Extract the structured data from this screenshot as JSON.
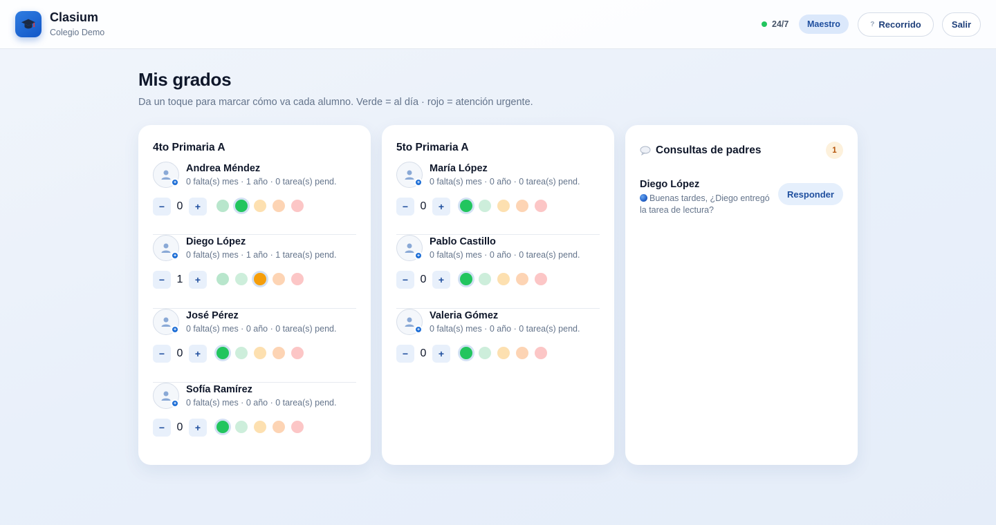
{
  "brand": {
    "name": "Clasium",
    "subtitle": "Colegio Demo"
  },
  "header": {
    "status_text": "24/7",
    "role": "Maestro",
    "tour_label": "Recorrido",
    "tour_icon": "?",
    "exit_label": "Salir"
  },
  "page": {
    "title": "Mis grados",
    "subtitle": "Da un toque para marcar cómo va cada alumno. Verde = al día · rojo = atención urgente."
  },
  "colors": {
    "green": "#22c55e",
    "green_light": "#b8e6cc",
    "mint_light": "#cdeedb",
    "amber": "#f59e0b",
    "amber_light": "#fde0b0",
    "orange_light": "#fdd4b4",
    "red_light": "#fcc6c6",
    "accent": "#1f6fd6"
  },
  "classes": [
    {
      "title": "4to Primaria A",
      "students": [
        {
          "name": "Andrea Méndez",
          "meta": "0 falta(s) mes · 1 año · 0 tarea(s) pend.",
          "count": "0",
          "status": 1,
          "minus": "−",
          "plus": "+"
        },
        {
          "name": "Diego López",
          "meta": "0 falta(s) mes · 1 año · 1 tarea(s) pend.",
          "count": "1",
          "status": 2,
          "minus": "−",
          "plus": "+"
        },
        {
          "name": "José Pérez",
          "meta": "0 falta(s) mes · 0 año · 0 tarea(s) pend.",
          "count": "0",
          "status": 0,
          "minus": "−",
          "plus": "+"
        },
        {
          "name": "Sofía Ramírez",
          "meta": "0 falta(s) mes · 0 año · 0 tarea(s) pend.",
          "count": "0",
          "status": 0,
          "minus": "−",
          "plus": "+"
        }
      ]
    },
    {
      "title": "5to Primaria A",
      "students": [
        {
          "name": "María López",
          "meta": "0 falta(s) mes · 0 año · 0 tarea(s) pend.",
          "count": "0",
          "status": 0,
          "minus": "−",
          "plus": "+"
        },
        {
          "name": "Pablo Castillo",
          "meta": "0 falta(s) mes · 0 año · 0 tarea(s) pend.",
          "count": "0",
          "status": 0,
          "minus": "−",
          "plus": "+"
        },
        {
          "name": "Valeria Gómez",
          "meta": "0 falta(s) mes · 0 año · 0 tarea(s) pend.",
          "count": "0",
          "status": 0,
          "minus": "−",
          "plus": "+"
        }
      ]
    }
  ],
  "queries": {
    "title": "Consultas de padres",
    "count": "1",
    "items": [
      {
        "parent": "Diego López",
        "message": "Buenas tardes, ¿Diego entregó la tarea de lectura?",
        "reply_label": "Responder"
      }
    ]
  }
}
